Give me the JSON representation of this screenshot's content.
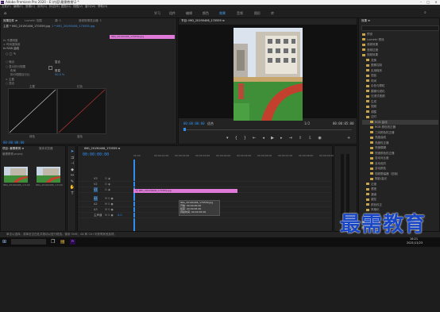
{
  "window": {
    "title": "Adobe Premiere Pro 2020 - E:\\内容\\最需教育\\1 *",
    "logo_text": "Pr"
  },
  "menu": [
    "文件(F)",
    "编辑(E)",
    "剪辑(C)",
    "序列(S)",
    "标记(M)",
    "图形(G)",
    "视图(V)",
    "窗口(W)",
    "帮助(H)"
  ],
  "workspaces": [
    "学习",
    "组件",
    "编辑",
    "颜色",
    "效果",
    "音频",
    "图形",
    "库"
  ],
  "effect_controls": {
    "tabs": [
      "效果控件 ≡",
      "Lumetri 范围",
      "源: 1",
      "音频剪辑混合器: 1"
    ],
    "source_label": "主要 * IMG_20190406_170559.jpg",
    "sequence_label": "1 * IMG_20190406_170559.jpg",
    "clip_label": "IMG_20190406_170559.jpg",
    "rows": [
      "fx 不透明度",
      "> 时间重映射",
      "fx RGB 曲线",
      "○ 输出",
      "○ 显示拆分视图",
      "布局",
      "拆分视图百分比",
      "> 主要",
      "○ 混合"
    ],
    "output_value": "复合",
    "layout_value": "垂直",
    "percent_value": "50.0 %",
    "curve_labels": [
      "主要",
      "红色",
      "绿色",
      "蓝色"
    ],
    "timecode": "00:00:00:00"
  },
  "program_monitor": {
    "title": "节目: IMG_20190406_170559 ≡",
    "timecode_left": "00:00:00:00",
    "fit_label": "适合",
    "quality_label": "完整",
    "timecode_right": "00:00:05:00",
    "zoom_label": "1/2"
  },
  "effects_panel": {
    "title": "效果 ≡",
    "items": [
      "预设",
      "Lumetri 预设",
      "音频效果",
      "音频过渡",
      "视频效果",
      "变换",
      "图像控制",
      "实用程序",
      "扭曲",
      "时间",
      "杂色与颗粒",
      "模糊与锐化",
      "沉浸式视频",
      "生成",
      "视频",
      "调整",
      "过时",
      "RGB 曲线",
      "RGB 颜色校正器",
      "三向颜色校正器",
      "亮度曲线",
      "亮度校正器",
      "快速模糊",
      "快速颜色校正器",
      "自动对比度",
      "自动色阶",
      "自动颜色",
      "视频限幅器（旧版）",
      "阴影/高光",
      "过渡",
      "透视",
      "通道",
      "键控",
      "颜色校正",
      "风格化"
    ],
    "section_label": "基本图形",
    "icons_label": "基本声音"
  },
  "project_panel": {
    "tabs": [
      "项目: 最需教育 ≡",
      "媒体浏览器"
    ],
    "file_label": "最需教育.prproj",
    "search_placeholder": "",
    "items": [
      {
        "name": "IMG_20190406_1...",
        "duration": "5:00"
      },
      {
        "name": "IMG_20190406_1...",
        "duration": "5:00"
      }
    ]
  },
  "timeline": {
    "title": "IMG_20190406_170559 ≡",
    "timecode": "00:00:00:00",
    "ruler": [
      "00:00",
      "00:00:01:00",
      "00:00:02:00",
      "00:00:03:00",
      "00:00:04:00",
      "00:00:05:00",
      "00:00:06:00",
      "00:00:07:00",
      "00:00:08:00",
      "00:00:09:00"
    ],
    "tracks": [
      "V3",
      "V2",
      "V1",
      "A1",
      "A2",
      "A3",
      "主声道"
    ],
    "master_value": "0.0",
    "clip_label": "fx IMG_20190406_170559.jpg",
    "tooltip": [
      "IMG_20190406_170559.jpg",
      "开始: 00:00:00:00",
      "结束: 00:00:05:00",
      "持续时间: 00:00:05:00"
    ]
  },
  "status_text": "单击以选择，或单击空白处并拖动以进行框选。使用 Shift、Alt 和 Ctrl 可获得其他选项。",
  "clock": {
    "time": "16:21",
    "date": "2021/11/23"
  },
  "watermark": "最需教育",
  "colors": {
    "accent": "#3d8fe0",
    "clip": "#e07ad8",
    "watermark": "#1846c4"
  }
}
